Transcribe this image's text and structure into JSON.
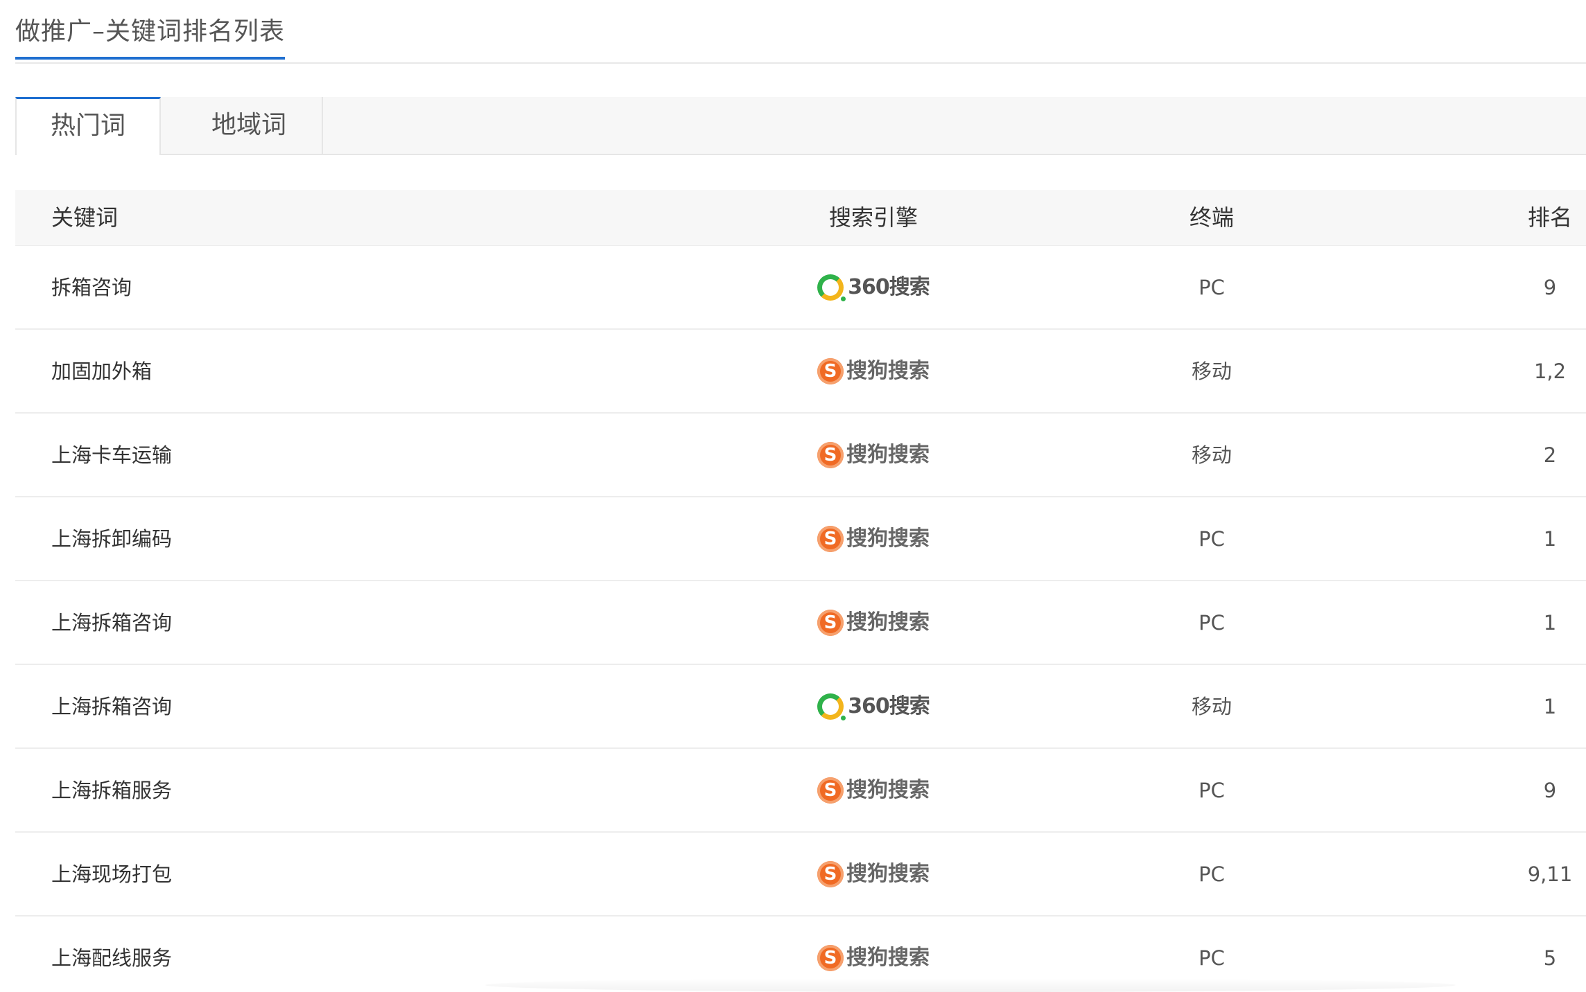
{
  "header": {
    "title": "做推广–关键词排名列表"
  },
  "tabs": [
    {
      "label": "热门词",
      "active": true
    },
    {
      "label": "地域词",
      "active": false
    }
  ],
  "table": {
    "columns": [
      "关键词",
      "搜索引擎",
      "终端",
      "排名"
    ],
    "rows": [
      {
        "keyword": "拆箱咨询",
        "engine": "360",
        "engine_text": "360搜索",
        "terminal": "PC",
        "rank": "9"
      },
      {
        "keyword": "加固加外箱",
        "engine": "sogou",
        "engine_text": "搜狗搜索",
        "terminal": "移动",
        "rank": "1,2"
      },
      {
        "keyword": "上海卡车运输",
        "engine": "sogou",
        "engine_text": "搜狗搜索",
        "terminal": "移动",
        "rank": "2"
      },
      {
        "keyword": "上海拆卸编码",
        "engine": "sogou",
        "engine_text": "搜狗搜索",
        "terminal": "PC",
        "rank": "1"
      },
      {
        "keyword": "上海拆箱咨询",
        "engine": "sogou",
        "engine_text": "搜狗搜索",
        "terminal": "PC",
        "rank": "1"
      },
      {
        "keyword": "上海拆箱咨询",
        "engine": "360",
        "engine_text": "360搜索",
        "terminal": "移动",
        "rank": "1"
      },
      {
        "keyword": "上海拆箱服务",
        "engine": "sogou",
        "engine_text": "搜狗搜索",
        "terminal": "PC",
        "rank": "9"
      },
      {
        "keyword": "上海现场打包",
        "engine": "sogou",
        "engine_text": "搜狗搜索",
        "terminal": "PC",
        "rank": "9,11"
      },
      {
        "keyword": "上海配线服务",
        "engine": "sogou",
        "engine_text": "搜狗搜索",
        "terminal": "PC",
        "rank": "5"
      }
    ]
  },
  "icons": {
    "360": "360-search-logo",
    "sogou": "sogou-search-logo"
  },
  "colors": {
    "accent": "#1f6fd0",
    "sogou": "#f06a24",
    "green360": "#2fb24a",
    "yellow360": "#f3b51c"
  }
}
